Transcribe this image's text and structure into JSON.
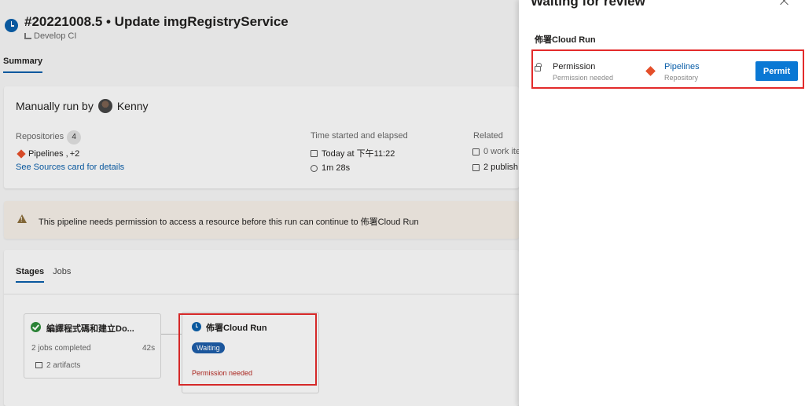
{
  "run": {
    "title": "#20221008.5 • Update imgRegistryService",
    "pipeline": "Develop CI"
  },
  "tabs": {
    "summary": "Summary"
  },
  "summary_card": {
    "manually_run_by": "Manually run by",
    "user": "Kenny",
    "repositories_label": "Repositories",
    "repositories_count": "4",
    "repo_name": "Pipelines",
    "repo_more": "+2",
    "repo_separator": ",",
    "sources_link": "See Sources card for details",
    "time_label": "Time started and elapsed",
    "time_started": "Today at 下午11:22",
    "elapsed": "1m 28s",
    "related_label": "Related",
    "related_work_items": "0 work ite",
    "related_published": "2 publish"
  },
  "warning": {
    "text": "This pipeline needs permission to access a resource before this run can continue to 佈署Cloud Run"
  },
  "stages_card": {
    "tab_stages": "Stages",
    "tab_jobs": "Jobs",
    "stage1": {
      "name": "編譯程式碼和建立Do...",
      "jobs": "2 jobs completed",
      "duration": "42s",
      "artifacts": "2 artifacts"
    },
    "stage2": {
      "name": "佈署Cloud Run",
      "status": "Waiting",
      "note": "Permission needed"
    }
  },
  "panel": {
    "title": "Waiting for review",
    "environment": "佈署Cloud Run",
    "permission_title": "Permission",
    "permission_sub": "Permission needed",
    "resource_name": "Pipelines",
    "resource_type": "Repository",
    "permit_label": "Permit"
  },
  "colors": {
    "accent": "#0a78d4",
    "highlight": "#e32b2b",
    "success": "#2e8b3a",
    "warning_bg": "#f3ece5",
    "git": "#e44f2a"
  }
}
